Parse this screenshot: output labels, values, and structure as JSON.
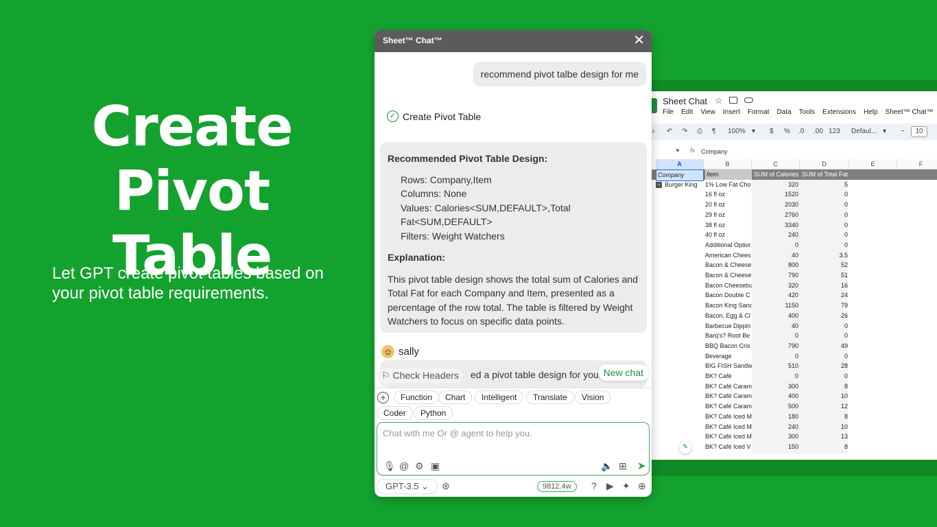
{
  "hero": {
    "title_line1": "Create",
    "title_line2": "Pivot Table",
    "subtitle": "Let GPT create pivot tables based on your pivot table requirements."
  },
  "sheet": {
    "title": "Sheet Chat",
    "menu": [
      "File",
      "Edit",
      "View",
      "Insert",
      "Format",
      "Data",
      "Tools",
      "Extensions",
      "Help",
      "Sheet™ Chat™"
    ],
    "toolbar": {
      "zoom": "100%",
      "currency": "$",
      "percent": "%",
      "dec_less": ".0",
      "dec_more": ".00",
      "format_123": "123",
      "font": "Defaul...",
      "minus": "−",
      "size": "10"
    },
    "formula_value": "Company",
    "columns": [
      "A",
      "B",
      "C",
      "D",
      "E",
      "F"
    ],
    "header": {
      "company": "Company",
      "item": "Item",
      "calories": "SUM of Calories",
      "fat": "SUM of Total Fat"
    },
    "group_company": "Burger King",
    "rows": [
      [
        "1% Low Fat Cho",
        "320",
        "5"
      ],
      [
        "16 fl oz",
        "1520",
        "0"
      ],
      [
        "20 fl oz",
        "2030",
        "0"
      ],
      [
        "29 fl oz",
        "2760",
        "0"
      ],
      [
        "38 fl oz",
        "3340",
        "0"
      ],
      [
        "40 fl oz",
        "240",
        "0"
      ],
      [
        "Additional Optior",
        "0",
        "0"
      ],
      [
        "American Chees",
        "40",
        "3.5"
      ],
      [
        "Bacon & Cheese",
        "800",
        "52"
      ],
      [
        "Bacon & Cheese",
        "790",
        "51"
      ],
      [
        "Bacon Cheesebu",
        "320",
        "16"
      ],
      [
        "Bacon Double C",
        "420",
        "24"
      ],
      [
        "Bacon King Sand",
        "1150",
        "79"
      ],
      [
        "Bacon, Egg & Cl",
        "400",
        "26"
      ],
      [
        "Barbecue Dippin",
        "40",
        "0"
      ],
      [
        "Barq's? Root Be",
        "0",
        "0"
      ],
      [
        "BBQ Bacon Cris",
        "790",
        "49"
      ],
      [
        "Beverage",
        "0",
        "0"
      ],
      [
        "BIG FISH Sandw",
        "510",
        "28"
      ],
      [
        "BK? Café",
        "0",
        "0"
      ],
      [
        "BK? Café Caram",
        "300",
        "8"
      ],
      [
        "BK? Café Caram",
        "400",
        "10"
      ],
      [
        "BK? Café Caram",
        "500",
        "12"
      ],
      [
        "BK? Café Iced M",
        "180",
        "8"
      ],
      [
        "BK? Café Iced M",
        "240",
        "10"
      ],
      [
        "BK? Café Iced M",
        "300",
        "13"
      ],
      [
        "BK? Café Iced V",
        "150",
        "8"
      ]
    ]
  },
  "chat": {
    "header_title": "Sheet™ Chat™",
    "close_glyph": "✕",
    "user_message": "recommend pivot talbe design for me",
    "status_text": "Create Pivot Table",
    "bot": {
      "heading": "Recommended Pivot Table Design:",
      "rows": "Rows: Company,Item",
      "columns": "Columns: None",
      "values": "Values: Calories<SUM,DEFAULT>,Total Fat<SUM,DEFAULT>",
      "filters": "Filters: Weight Watchers",
      "explanation_heading": "Explanation:",
      "explanation": "This pivot table design shows the total sum of Calories and Total Fat for each Company and Item, presented as a percentage of the row total. The table is filtered by Weight Watchers to focus on specific data points."
    },
    "user_name": "sally",
    "partial_text": "ed a pivot table design for you.",
    "check_headers": "Check Headers",
    "new_chat": "New chat",
    "chips": [
      "Function",
      "Chart",
      "Intelligent",
      "Translate",
      "Vision",
      "Coder",
      "Python"
    ],
    "input_placeholder": "Chat with me Or @ agent to help you.",
    "model": "GPT-3.5",
    "tokens": "9812.4w"
  },
  "colors": {
    "background": "#14a22f",
    "accent": "#39a857",
    "sheet_green": "#1e8e3e"
  }
}
